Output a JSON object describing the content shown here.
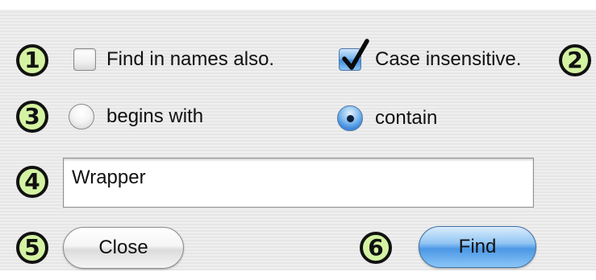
{
  "callouts": [
    "1",
    "2",
    "3",
    "4",
    "5",
    "6"
  ],
  "options": {
    "find_in_names": {
      "label": "Find in names also.",
      "checked": false
    },
    "case_insensitive": {
      "label": "Case insensitive.",
      "checked": true
    },
    "match_mode": {
      "begins_with_label": "begins with",
      "contain_label": "contain",
      "selected": "contain"
    }
  },
  "search": {
    "value": "Wrapper"
  },
  "buttons": {
    "close_label": "Close",
    "find_label": "Find"
  },
  "colors": {
    "callout_fill": "#d4f3a2",
    "accent_blue": "#4c98e6"
  }
}
